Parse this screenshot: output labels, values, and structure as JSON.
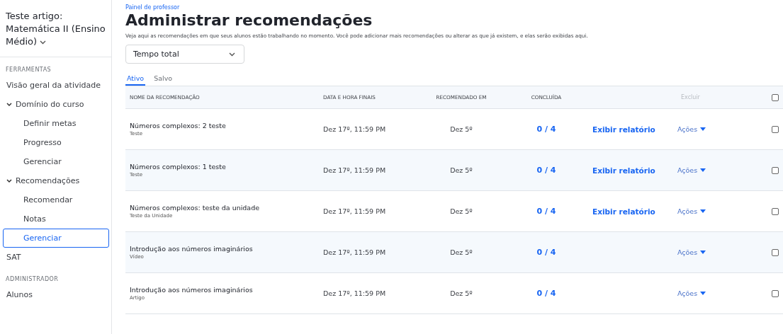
{
  "sidebar": {
    "course_title": "Teste artigo: Matemática II (Ensino Médio)",
    "sections": [
      {
        "heading": "FERRAMENTAS",
        "items": [
          {
            "label": "Visão geral da atividade",
            "selected": false
          },
          {
            "label": "Domínio do curso",
            "expanded": true,
            "selected": false,
            "children": [
              {
                "label": "Definir metas",
                "selected": false
              },
              {
                "label": "Progresso",
                "selected": false
              },
              {
                "label": "Gerenciar",
                "selected": false
              }
            ]
          },
          {
            "label": "Recomendações",
            "expanded": true,
            "selected": false,
            "children": [
              {
                "label": "Recomendar",
                "selected": false
              },
              {
                "label": "Notas",
                "selected": false
              },
              {
                "label": "Gerenciar",
                "selected": true
              }
            ]
          },
          {
            "label": "SAT",
            "selected": false
          }
        ]
      },
      {
        "heading": "ADMINISTRADOR",
        "items": [
          {
            "label": "Alunos",
            "selected": false
          }
        ]
      }
    ]
  },
  "breadcrumb": "Painel de professor",
  "title": "Administrar recomendações",
  "description": "Veja aqui as recomendações em que seus alunos estão trabalhando no momento. Você pode adicionar mais recomendações ou alterar as que já existem, e elas serão exibidas aqui.",
  "filter": {
    "value": "Tempo total"
  },
  "tabs": [
    {
      "label": "Ativo",
      "selected": true
    },
    {
      "label": "Salvo",
      "selected": false
    }
  ],
  "table": {
    "columns": [
      "NOME DA RECOMENDAÇÃO",
      "DATA E HORA FINAIS",
      "RECOMENDADO EM",
      "CONCLUÍDA"
    ],
    "delete": {
      "label": "Excluir",
      "disabled": true
    },
    "select_all": {
      "checked": false
    },
    "rows": [
      {
        "name": "Números complexos: 2 teste",
        "type": "Teste",
        "due": "Dez 17º, 11:59 PM",
        "recommended": "Dez 5º",
        "completed": "0 / 4",
        "report": "Exibir relatório",
        "actions": "Ações",
        "checked": false
      },
      {
        "name": "Números complexos: 1 teste",
        "type": "Teste",
        "due": "Dez 17º, 11:59 PM",
        "recommended": "Dez 5º",
        "completed": "0 / 4",
        "report": "Exibir relatório",
        "actions": "Ações",
        "checked": false
      },
      {
        "name": "Números complexos: teste da unidade",
        "type": "Teste da Unidade",
        "due": "Dez 17º, 11:59 PM",
        "recommended": "Dez 5º",
        "completed": "0 / 4",
        "report": "Exibir relatório",
        "actions": "Ações",
        "checked": false
      },
      {
        "name": "Introdução aos números imaginários",
        "type": "Vídeo",
        "due": "Dez 17º, 11:59 PM",
        "recommended": "Dez 5º",
        "completed": "0 / 4",
        "actions": "Ações",
        "checked": false
      },
      {
        "name": "Introdução aos números imaginários",
        "type": "Artigo",
        "due": "Dez 17º, 11:59 PM",
        "recommended": "Dez 5º",
        "completed": "0 / 4",
        "actions": "Ações",
        "checked": false
      }
    ]
  }
}
